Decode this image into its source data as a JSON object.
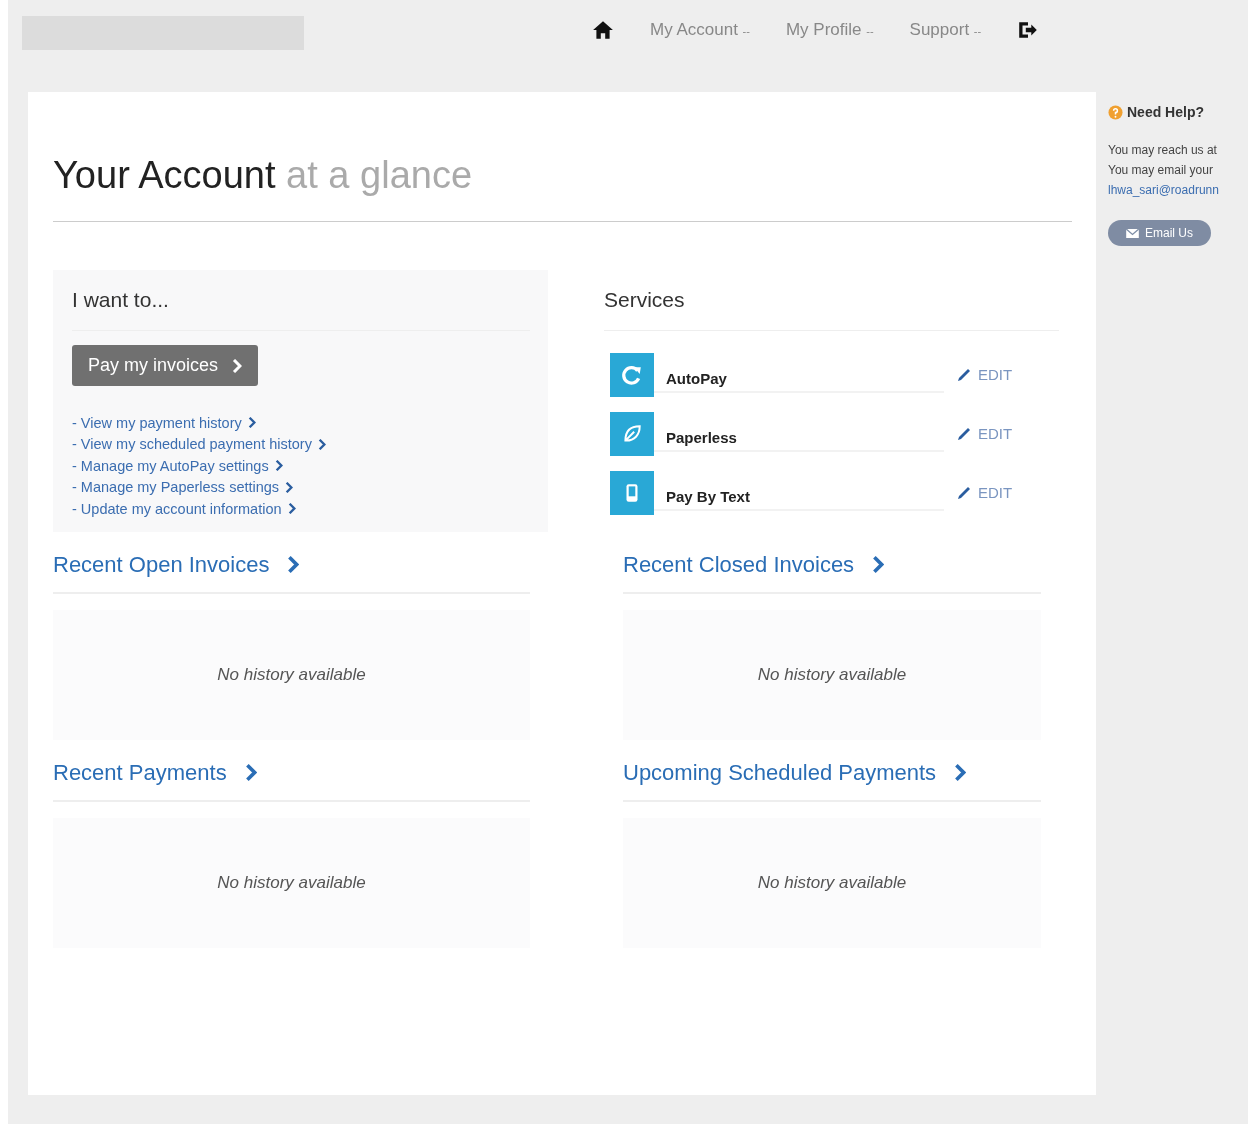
{
  "nav": {
    "items": [
      {
        "label": "My Account",
        "caret": "--"
      },
      {
        "label": "My Profile",
        "caret": "--"
      },
      {
        "label": "Support",
        "caret": "--"
      }
    ]
  },
  "title": {
    "main": "Your Account",
    "sub": "at a glance"
  },
  "actions": {
    "heading": "I want to...",
    "button": "Pay my invoices",
    "links": [
      "- View my payment history",
      "- View my scheduled payment history",
      "- Manage my AutoPay settings",
      "- Manage my Paperless settings",
      "- Update my account information"
    ]
  },
  "services": {
    "heading": "Services",
    "items": [
      {
        "kind": "autopay",
        "name": "AutoPay",
        "action": "EDIT"
      },
      {
        "kind": "paperless",
        "name": "Paperless",
        "action": "EDIT"
      },
      {
        "kind": "text",
        "name": "Pay By Text",
        "action": "EDIT"
      }
    ]
  },
  "panels": [
    {
      "title": "Recent Open Invoices",
      "empty": "No history available"
    },
    {
      "title": "Recent Closed Invoices",
      "empty": "No history available"
    },
    {
      "title": "Recent Payments",
      "empty": "No history available"
    },
    {
      "title": "Upcoming Scheduled Payments",
      "empty": "No history available"
    }
  ],
  "help": {
    "title": "Need Help?",
    "lines": [
      "You may reach us at",
      "You may email your"
    ],
    "email": "lhwa_sari@roadrunn",
    "button": "Email Us"
  }
}
